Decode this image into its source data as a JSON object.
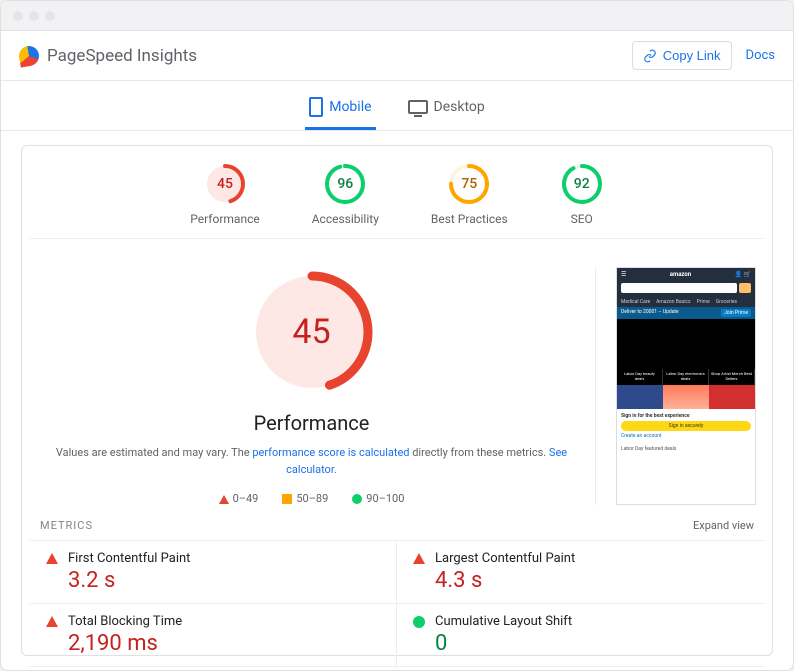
{
  "header": {
    "title": "PageSpeed Insights",
    "copy_link": "Copy Link",
    "docs": "Docs"
  },
  "tabs": {
    "mobile": "Mobile",
    "desktop": "Desktop"
  },
  "scores": {
    "performance": {
      "score": "45",
      "label": "Performance"
    },
    "accessibility": {
      "score": "96",
      "label": "Accessibility"
    },
    "best_practices": {
      "score": "75",
      "label": "Best Practices"
    },
    "seo": {
      "score": "92",
      "label": "SEO"
    }
  },
  "gauge": {
    "score": "45",
    "label": "Performance",
    "explain_prefix": "Values are estimated and may vary. The ",
    "explain_link1": "performance score is calculated",
    "explain_mid": " directly from these metrics. ",
    "explain_link2": "See calculator."
  },
  "legend": {
    "bad": "0–49",
    "mid": "50–89",
    "good": "90–100"
  },
  "thumb": {
    "brand": "amazon",
    "nav1": "Medical Care",
    "nav2": "Amazon Basics",
    "nav3": "Prime",
    "nav4": "Groceries",
    "bluebar_left": "Deliver to 20001 – Update",
    "bluebar_right": "Join Prime",
    "cat1": "Labor Day beauty deals",
    "cat2": "Labor Day electronics deals",
    "cat3": "Shop Artist Merch Best Sellers",
    "signin_title": "Sign in for the best experience",
    "signin_btn": "Sign in securely",
    "signin_sub": "Create an account",
    "footer": "Labor Day featured deals"
  },
  "metrics": {
    "header": "METRICS",
    "expand": "Expand view",
    "fcp": {
      "name": "First Contentful Paint",
      "value": "3.2 s"
    },
    "lcp": {
      "name": "Largest Contentful Paint",
      "value": "4.3 s"
    },
    "tbt": {
      "name": "Total Blocking Time",
      "value": "2,190 ms"
    },
    "cls": {
      "name": "Cumulative Layout Shift",
      "value": "0"
    }
  }
}
